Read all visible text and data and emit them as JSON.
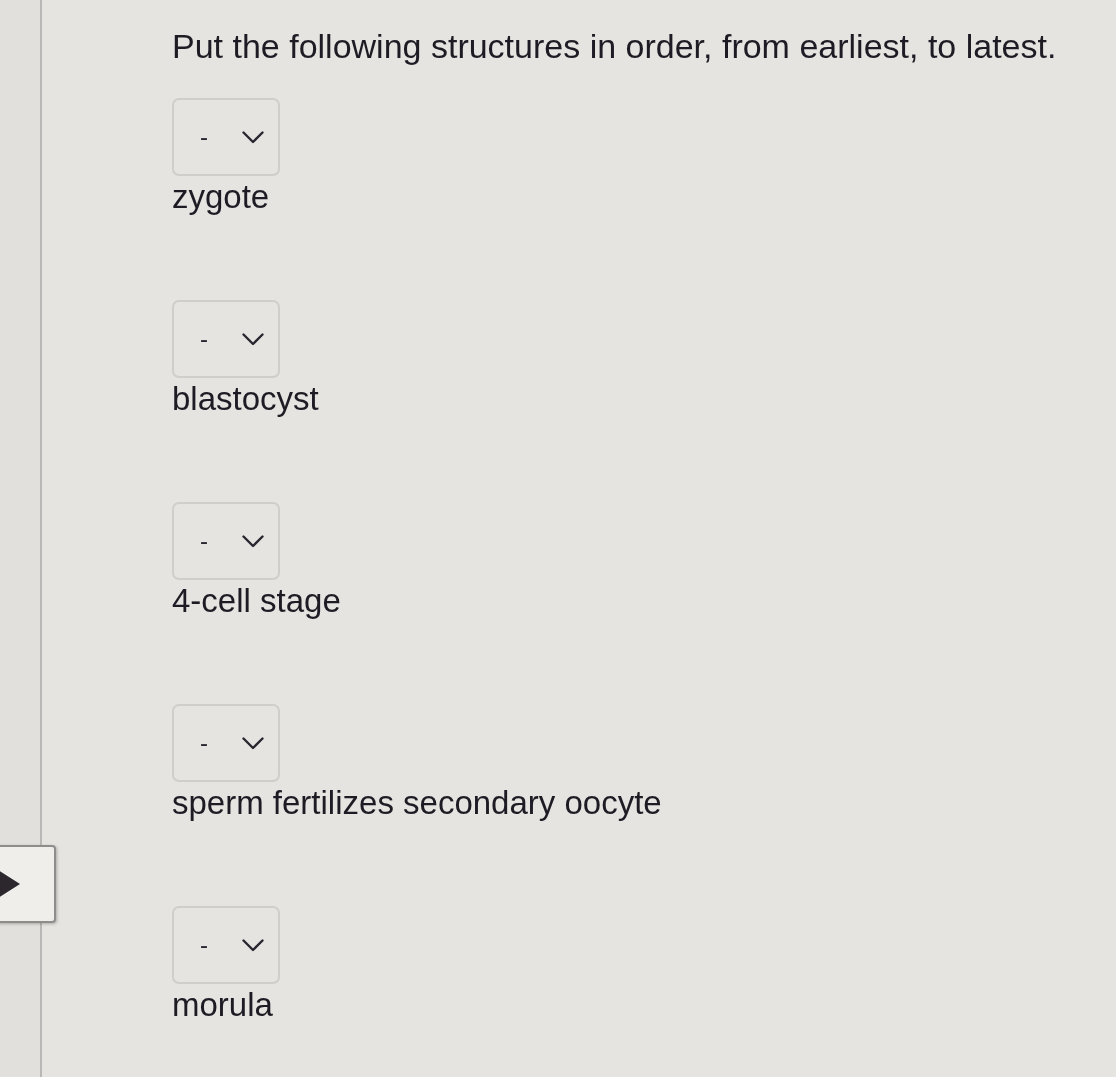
{
  "prompt": "Put the following structures in order, from earliest, to latest.",
  "items": [
    {
      "select": {
        "value": "-"
      },
      "label": "zygote"
    },
    {
      "select": {
        "value": "-"
      },
      "label": "blastocyst"
    },
    {
      "select": {
        "value": "-"
      },
      "label": "4-cell stage"
    },
    {
      "select": {
        "value": "-"
      },
      "label": "sperm fertilizes secondary oocyte"
    },
    {
      "select": {
        "value": "-"
      },
      "label": "morula"
    }
  ]
}
